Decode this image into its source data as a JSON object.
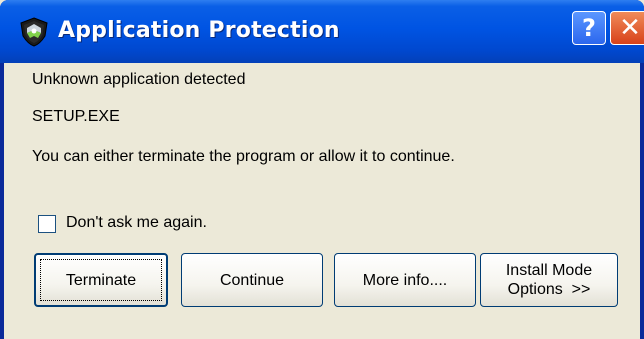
{
  "window": {
    "title": "Application Protection",
    "help_symbol": "?",
    "close_symbol": "✕",
    "title_icon": "shield-icon"
  },
  "message": {
    "line1": "Unknown application detected",
    "filename": "SETUP.EXE",
    "line3": "You can either terminate the program or allow it to continue."
  },
  "checkbox": {
    "label": "Don't ask me again.",
    "checked": false
  },
  "buttons": {
    "terminate": "Terminate",
    "continue": "Continue",
    "more_info": "More info....",
    "install_line1": "Install Mode",
    "install_line2": "Options  >>"
  },
  "colors": {
    "titlebar": "#0054e3",
    "client_bg": "#ece9d8",
    "close_btn": "#d8421a"
  }
}
